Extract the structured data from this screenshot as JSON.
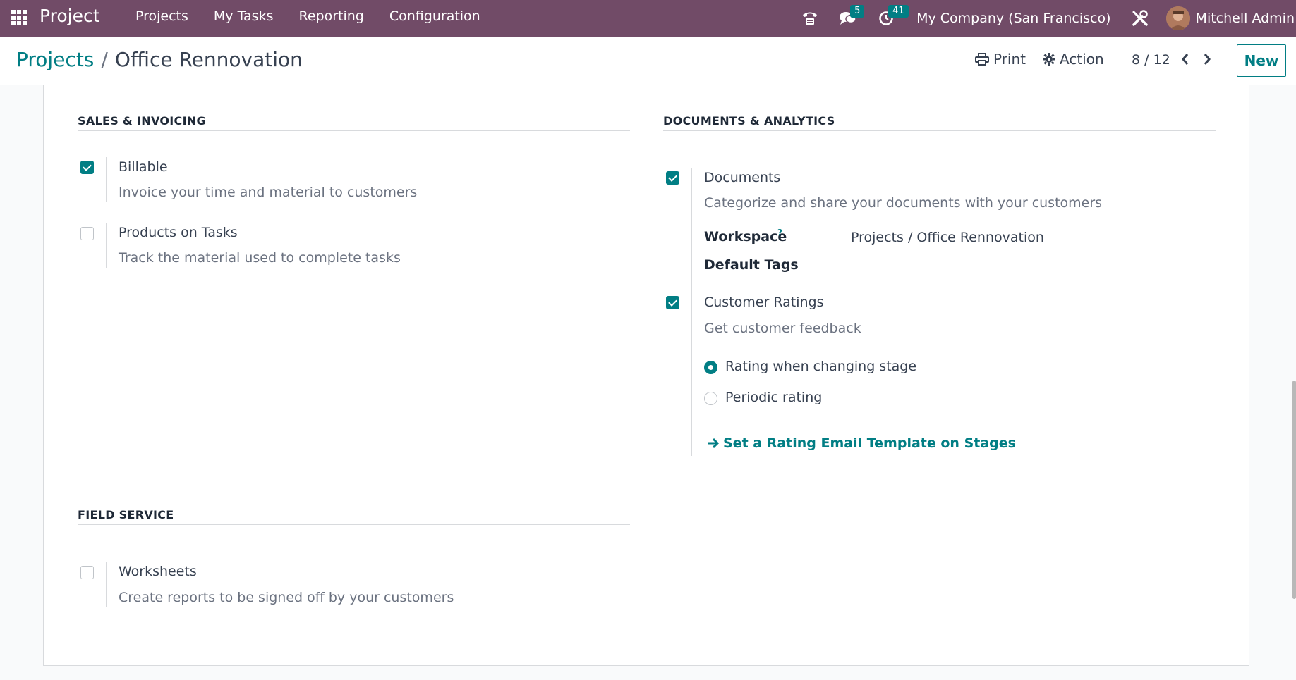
{
  "navbar": {
    "app_name": "Project",
    "menu": [
      "Projects",
      "My Tasks",
      "Reporting",
      "Configuration"
    ],
    "messages_count": "5",
    "activities_count": "41",
    "company": "My Company (San Francisco)",
    "user": "Mitchell Admin",
    "bg_color": "#714b67"
  },
  "control": {
    "breadcrumb_parent": "Projects",
    "breadcrumb_sep": "/",
    "breadcrumb_current": "Office Rennovation",
    "print_label": "Print",
    "action_label": "Action",
    "pager": "8 / 12",
    "new_label": "New"
  },
  "sales": {
    "title": "SALES & INVOICING",
    "billable": {
      "title": "Billable",
      "desc": "Invoice your time and material to customers",
      "checked": true
    },
    "products": {
      "title": "Products on Tasks",
      "desc": "Track the material used to complete tasks",
      "checked": false
    }
  },
  "documents": {
    "title": "DOCUMENTS & ANALYTICS",
    "docs": {
      "title": "Documents",
      "desc": "Categorize and share your documents with your customers",
      "checked": true
    },
    "workspace_label": "Workspace",
    "workspace_help": "?",
    "workspace_value": "Projects / Office Rennovation",
    "default_tags_label": "Default Tags",
    "ratings": {
      "title": "Customer Ratings",
      "desc": "Get customer feedback",
      "checked": true
    },
    "radio_options": [
      "Rating when changing stage",
      "Periodic rating"
    ],
    "selected_option": "Rating when changing stage",
    "link_label": "Set a Rating Email Template on Stages"
  },
  "field_service": {
    "title": "FIELD SERVICE",
    "worksheets": {
      "title": "Worksheets",
      "desc": "Create reports to be signed off by your customers",
      "checked": false
    }
  },
  "colors": {
    "accent": "#017e84",
    "navbar": "#714b67"
  }
}
